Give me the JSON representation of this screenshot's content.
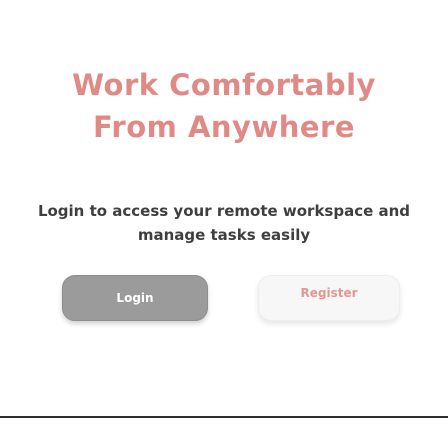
{
  "hero": {
    "title_line1": "Work Comfortably",
    "title_line2": "From Anywhere",
    "subtitle": "Login to access your remote workspace and manage tasks easily"
  },
  "actions": {
    "login_label": "Login",
    "register_label": "Register"
  },
  "colors": {
    "title": "#e08a86",
    "subtitle": "#3f3f3f",
    "login_bg": "#9b9b9b",
    "register_bg": "#f7f7f7",
    "register_text": "#e89590"
  }
}
